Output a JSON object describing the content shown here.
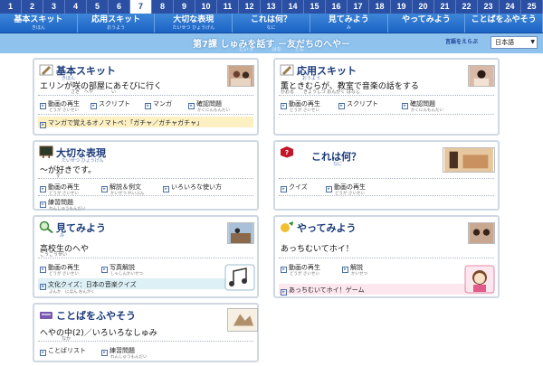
{
  "lesson_bar": {
    "numbers": [
      "1",
      "2",
      "3",
      "4",
      "5",
      "6",
      "7",
      "8",
      "9",
      "10",
      "11",
      "12",
      "13",
      "14",
      "15",
      "16",
      "17",
      "18",
      "19",
      "20",
      "21",
      "22",
      "23",
      "24",
      "25"
    ],
    "active": "7"
  },
  "sections": [
    {
      "label": "基本スキット",
      "ruby": "きほん"
    },
    {
      "label": "応用スキット",
      "ruby": "おうよう"
    },
    {
      "label": "大切な表現",
      "ruby": "たいせつ ひょうげん"
    },
    {
      "label": "これは何？",
      "ruby": "なに"
    },
    {
      "label": "見てみよう",
      "ruby": "み"
    },
    {
      "label": "やってみよう",
      "ruby": ""
    },
    {
      "label": "ことばをふやそう",
      "ruby": ""
    }
  ],
  "title": {
    "text": "第7課 しゅみを話す －友だちのへや－",
    "ruby": "だい か　　　　はな　　　とも",
    "lang_label": "言語をえらぶ",
    "lang_value": "日本語"
  },
  "cards": {
    "kihon": {
      "title": "基本スキット",
      "title_ruby": "きほん",
      "sub": "エリンが咲の部屋にあそびに行く",
      "sub_ruby": "さき　へや　　　　い",
      "links": [
        "動画の再生",
        "スクリプト",
        "マンガ",
        "確認問題"
      ],
      "links_ruby": [
        "どうが さいせい",
        "",
        "",
        "かくにんもんだい"
      ],
      "extra": "マンガで覚えるオノマトペ：「ガチャ／ガチャガチャ」"
    },
    "ouyou": {
      "title": "応用スキット",
      "title_ruby": "おうよう",
      "sub": "薫ときむらが、教室で音楽の話をする",
      "sub_ruby": "かおる　　きょうしつ おんがく はなし",
      "links": [
        "動画の再生",
        "スクリプト",
        "確認問題"
      ],
      "links_ruby": [
        "どうが さいせい",
        "",
        "かくにんもんだい"
      ]
    },
    "taisetsu": {
      "title": "大切な表現",
      "title_ruby": "たいせつ ひょうげん",
      "sub": "～が好きです。",
      "sub_ruby": "す",
      "links": [
        "動画の再生",
        "解説＆例文",
        "いろいろな使い方",
        "練習問題"
      ],
      "links_ruby": [
        "どうが さいせい",
        "かいせつ れいぶん",
        "つか かた",
        "れんしゅうもんだい"
      ]
    },
    "korewa": {
      "title": "これは何？",
      "title_ruby": "なに",
      "links": [
        "クイズ",
        "動画の再生"
      ],
      "links_ruby": [
        "",
        "どうが さいせい"
      ]
    },
    "mitemiyou": {
      "title": "見てみよう",
      "title_ruby": "み",
      "sub": "高校生のへや",
      "sub_ruby": "こうこうせい",
      "links": [
        "動画の再生",
        "写真解説"
      ],
      "links_ruby": [
        "どうが さいせい",
        "しゃしんかいせつ"
      ],
      "extra": "文化クイズ：日本の音楽クイズ",
      "extra_ruby": "ぶんか　にほん おんがく"
    },
    "yattemiyou": {
      "title": "やってみよう",
      "sub": "あっちむいてホイ！",
      "links": [
        "動画の再生",
        "解説"
      ],
      "links_ruby": [
        "どうが さいせい",
        "かいせつ"
      ],
      "extra": "あっちむいてホイ！ゲーム"
    },
    "kotoba": {
      "title": "ことばをふやそう",
      "sub": "へやの中(2)／いろいろなしゅみ",
      "sub_ruby": "なか",
      "links": [
        "ことばリスト",
        "練習問題"
      ],
      "links_ruby": [
        "",
        "れんしゅうもんだい"
      ]
    }
  },
  "colors": {
    "numbar": "#2a4fa3",
    "nav": "#1b63c4",
    "titlebar": "#8fc3ee",
    "accent": "#1a3a7a"
  }
}
